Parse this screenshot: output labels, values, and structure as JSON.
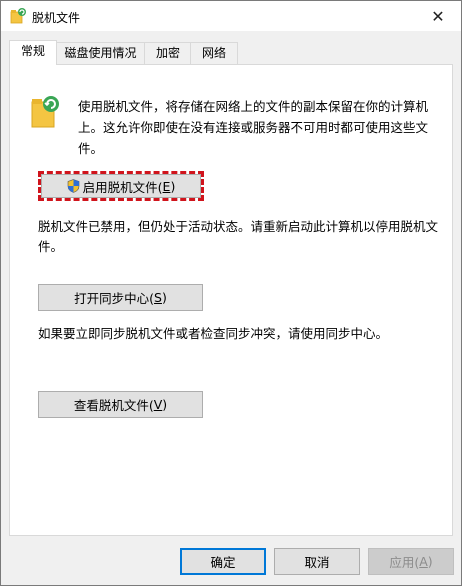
{
  "window": {
    "title": "脱机文件",
    "close_glyph": "✕"
  },
  "tabs": [
    {
      "label": "常规",
      "active": true
    },
    {
      "label": "磁盘使用情况",
      "active": false
    },
    {
      "label": "加密",
      "active": false
    },
    {
      "label": "网络",
      "active": false
    }
  ],
  "general": {
    "description_line1": "使用脱机文件，将存储在网络上的文件的副本保留在你的计算机",
    "description_line2": "上。这允许你即使在没有连接或服务器不可用时都可使用这些文件。",
    "enable_button": {
      "label": "启用脱机文件(",
      "key": "E",
      "end": ")"
    },
    "status_line1": "脱机文件已禁用，但仍处于活动状态。请重新启动此计算机以停用脱机文",
    "status_line2": "件。",
    "sync_button": {
      "label": "打开同步中心(",
      "key": "S",
      "end": ")"
    },
    "sync_hint": "如果要立即同步脱机文件或者检查同步冲突，请使用同步中心。",
    "view_button": {
      "label": "查看脱机文件(",
      "key": "V",
      "end": ")"
    }
  },
  "footer": {
    "ok_label": "确定",
    "cancel_label": "取消",
    "apply_label": "应用(",
    "apply_key": "A",
    "apply_end": ")"
  },
  "colors": {
    "highlight_border": "#d0141c",
    "default_button_border": "#0078d7",
    "folder_yellow": "#f4c542",
    "sync_green": "#3aa655"
  },
  "icons": {
    "title": "offline-files-icon",
    "folder": "sync-folder-icon",
    "shield": "uac-shield-icon"
  }
}
